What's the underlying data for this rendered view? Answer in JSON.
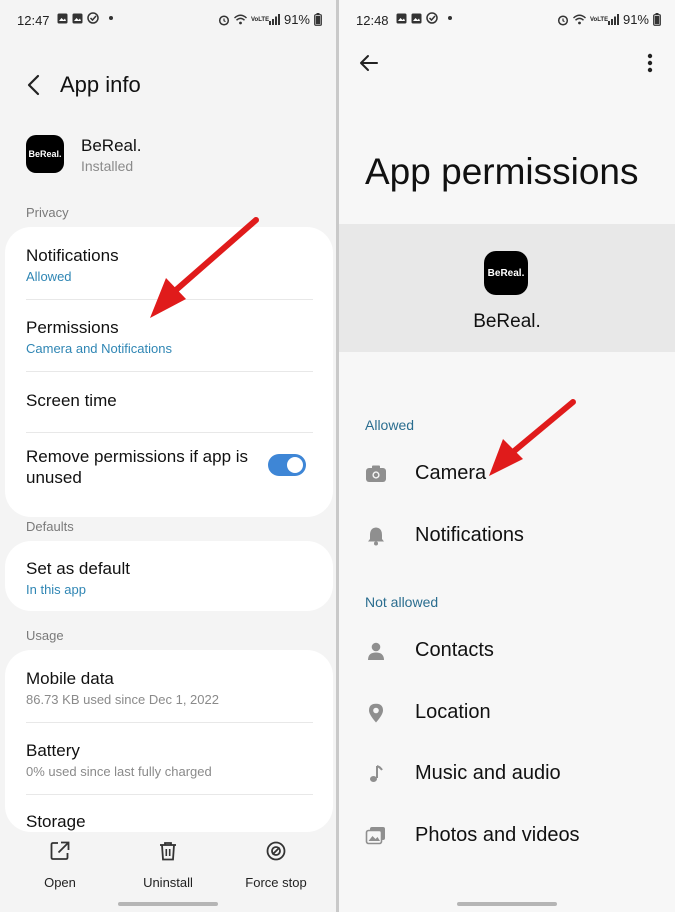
{
  "left": {
    "status": {
      "time": "12:47",
      "battery": "91%",
      "net": "VoLTE"
    },
    "header": {
      "title": "App info"
    },
    "app": {
      "name": "BeReal.",
      "status": "Installed",
      "logo_text": "BeReal."
    },
    "sections": {
      "privacy": "Privacy",
      "defaults": "Defaults",
      "usage": "Usage"
    },
    "privacy_items": {
      "notifications": {
        "title": "Notifications",
        "subtitle": "Allowed"
      },
      "permissions": {
        "title": "Permissions",
        "subtitle": "Camera and Notifications"
      },
      "screen_time": {
        "title": "Screen time"
      },
      "remove_unused": {
        "title": "Remove permissions if app is unused"
      }
    },
    "defaults_items": {
      "set_default": {
        "title": "Set as default",
        "subtitle": "In this app"
      }
    },
    "usage_items": {
      "mobile_data": {
        "title": "Mobile data",
        "subtitle": "86.73 KB used since Dec 1, 2022"
      },
      "battery": {
        "title": "Battery",
        "subtitle": "0% used since last fully charged"
      },
      "storage": {
        "title": "Storage"
      }
    },
    "bottom": {
      "open": "Open",
      "uninstall": "Uninstall",
      "force_stop": "Force stop"
    }
  },
  "right": {
    "status": {
      "time": "12:48",
      "battery": "91%",
      "net": "VoLTE"
    },
    "title": "App permissions",
    "app": {
      "name": "BeReal.",
      "logo_text": "BeReal."
    },
    "allowed_label": "Allowed",
    "allowed": [
      {
        "label": "Camera",
        "icon": "camera-icon"
      },
      {
        "label": "Notifications",
        "icon": "bell-icon"
      }
    ],
    "not_allowed_label": "Not allowed",
    "not_allowed": [
      {
        "label": "Contacts",
        "icon": "person-icon"
      },
      {
        "label": "Location",
        "icon": "location-pin-icon"
      },
      {
        "label": "Music and audio",
        "icon": "music-note-icon"
      },
      {
        "label": "Photos and videos",
        "icon": "photos-icon"
      }
    ]
  },
  "colors": {
    "accent_blue": "#2f86b4",
    "toggle_on": "#3e86d6",
    "arrow_red": "#e01b1b"
  }
}
